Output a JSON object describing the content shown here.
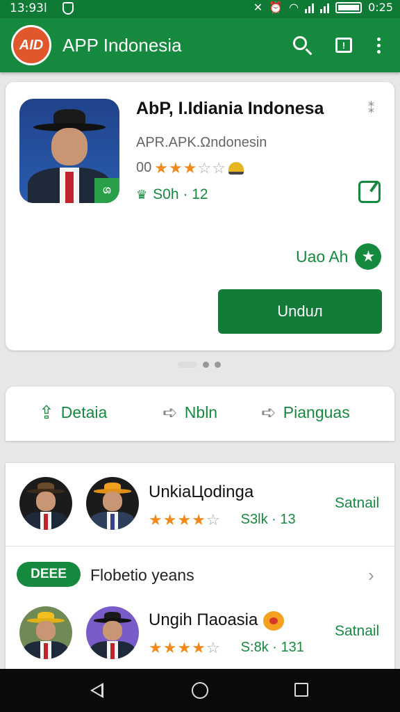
{
  "status_bar": {
    "time_left": "13:93l",
    "time_right": "0:25"
  },
  "app_bar": {
    "logo_text": "AID",
    "title": "APP Indonesia",
    "feedback_glyph": "!"
  },
  "app_card": {
    "title": "AbP, I.Idiania Indonesa",
    "close_glyph": "⁑",
    "developer": "APR.APK.Ωndonesin",
    "rating_prefix": "00",
    "rating_stars": 3,
    "size_text": "S0h · 12",
    "uac_label": "Uao Ah",
    "install_label": "Unduл",
    "avatar_badge": "ශ"
  },
  "carousel": {
    "page_count": 3,
    "active_index": 0
  },
  "actions": {
    "detail_label": "Detaia",
    "share_label": "Nbln",
    "more_label": "Pianguas"
  },
  "list": {
    "row1": {
      "title": "UnkiaЦodinga",
      "stars": 4,
      "meta": "S3lk · 13",
      "link": "Satnail"
    },
    "section": {
      "badge": "DEEE",
      "title": "Flobetio yeans"
    },
    "row2": {
      "title": "Ungih Паoasia",
      "stars": 4,
      "meta": "S:8k · 131",
      "link": "Satnail"
    }
  },
  "colors": {
    "brand_green": "#158a3e",
    "star": "#f08a1c",
    "logo_orange": "#e2562c"
  }
}
